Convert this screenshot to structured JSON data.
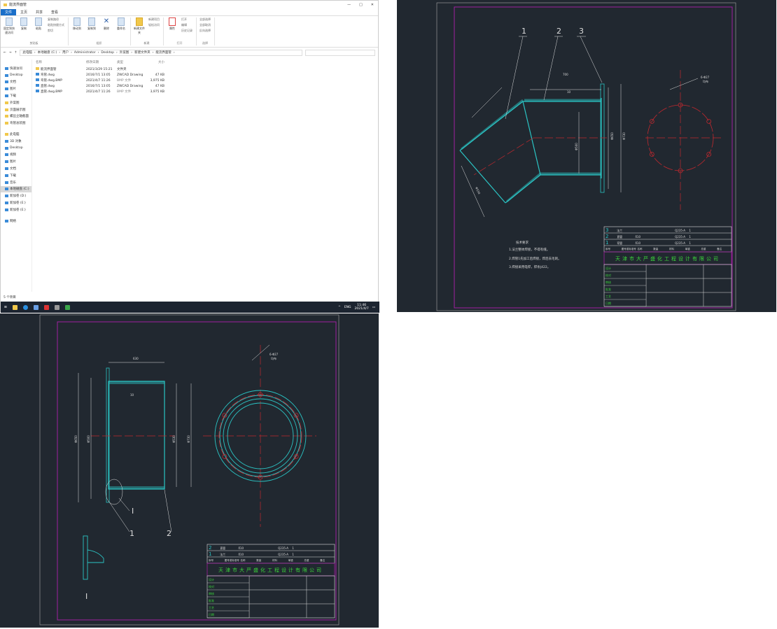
{
  "explorer": {
    "title": "能流界面管",
    "tabs": [
      "文件",
      "主页",
      "共享",
      "查看"
    ],
    "ribbon": {
      "clipboard": {
        "label": "剪贴板",
        "pin": "固定到快速访问",
        "copy": "复制",
        "paste": "粘贴",
        "copy_path": "复制路径",
        "paste_shortcut": "粘贴快捷方式",
        "cut": "剪切"
      },
      "organize": {
        "label": "组织",
        "move_to": "移动到",
        "copy_to": "复制到",
        "delete": "删除",
        "rename": "重命名"
      },
      "new": {
        "label": "新建",
        "new_folder": "新建文件夹",
        "new_item": "新建项目",
        "easy_access": "轻松访问"
      },
      "open": {
        "label": "打开",
        "properties": "属性",
        "open": "打开",
        "edit": "编辑",
        "history": "历史记录"
      },
      "select": {
        "label": "选择",
        "select_all": "全部选择",
        "select_none": "全部取消",
        "invert": "反向选择"
      }
    },
    "breadcrumb": [
      "此电脑",
      "本地磁盘 (C:)",
      "用户",
      "Administrator",
      "Desktop",
      "外案图",
      "新建文件夹",
      "能流界面管"
    ],
    "sidebar": [
      "快速访问",
      "Desktop",
      "文档",
      "图片",
      "下载",
      "外案图",
      "页面展示图",
      "螺丝立轴截面",
      "弯管总装图",
      "此电脑",
      "3D 对象",
      "Desktop",
      "视频",
      "图片",
      "文档",
      "下载",
      "音乐",
      "本地磁盘 (C:)",
      "新加卷 (D:)",
      "新加卷 (E:)",
      "新加卷 (E:)",
      "网络"
    ],
    "columns": [
      "名称",
      "修改日期",
      "类型",
      "大小"
    ],
    "files": [
      {
        "name": "能流界面管",
        "date": "2021/3/29 15:21",
        "type": "文件夹",
        "size": "",
        "icon": "folder-icon"
      },
      {
        "name": "弯管.dwg",
        "date": "2016/7/1 13:05",
        "type": "ZWCAD Drawing",
        "size": "47 KB",
        "icon": "dwg-file-icon"
      },
      {
        "name": "弯管.dwg.BMP",
        "date": "2021/4/7 11:26",
        "type": "BMP 文件",
        "size": "3,975 KB",
        "icon": "bmp-file-icon"
      },
      {
        "name": "直管.dwg",
        "date": "2016/7/1 13:05",
        "type": "ZWCAD Drawing",
        "size": "47 KB",
        "icon": "dwg-file-icon"
      },
      {
        "name": "直管.dwg.BMP",
        "date": "2021/4/7 11:26",
        "type": "BMP 文件",
        "size": "3,975 KB",
        "icon": "bmp-file-icon"
      }
    ],
    "status": "5 个项目",
    "taskbar": {
      "lang": "ENG",
      "time": "11:46",
      "date": "2021/4/7"
    }
  },
  "cad_elbow": {
    "labels": [
      "1",
      "2",
      "3"
    ],
    "dims": {
      "length": "700",
      "bolt": "6-Φ27",
      "even": "均布",
      "d1": "Φ730",
      "d2": "Φ650",
      "d3": "Φ500",
      "d4": "Φ530",
      "t": "10"
    },
    "notes_title": "技术要求",
    "notes": [
      "1.法兰整体焊接，不得有缝。",
      "2.焊管1先加工后焊接，焊后去毛刺。",
      "3.焊接采用电焊，焊条J422。"
    ],
    "parts": [
      {
        "no": "3",
        "name": "法兰",
        "mat": "Q235-A",
        "qty": "1"
      },
      {
        "no": "2",
        "name": "直管",
        "spec": "δ10",
        "mat": "Q235-A",
        "qty": "1"
      },
      {
        "no": "1",
        "name": "弯管",
        "spec": "δ10",
        "mat": "Q235-A",
        "qty": "1"
      }
    ],
    "header": [
      "序号",
      "图号或标准号",
      "名称",
      "数量",
      "材料",
      "单重",
      "总重",
      "备注"
    ],
    "company": "天津市大严盛化工程设计有限公司",
    "block": [
      "设计",
      "校对",
      "审核",
      "批准",
      "工艺",
      "日期"
    ]
  },
  "cad_straight": {
    "labels": [
      "1",
      "2",
      "I"
    ],
    "dims": {
      "length": "630",
      "bolt": "6-Φ27",
      "even": "均布",
      "d1": "Φ650",
      "d2": "Φ730",
      "d3": "Φ500",
      "d4": "Φ530",
      "t": "10"
    },
    "detail": "I",
    "parts": [
      {
        "no": "2",
        "name": "直管",
        "spec": "δ10",
        "mat": "Q235-A",
        "qty": "1"
      },
      {
        "no": "1",
        "name": "法兰",
        "spec": "δ10",
        "mat": "Q235-A",
        "qty": "1"
      }
    ],
    "company": "天津市大严盛化工程设计有限公司"
  },
  "colors": {
    "cad_bg": "#212830",
    "cyan": "#2bc4c4",
    "red": "#c0282e",
    "magenta": "#a020a0",
    "green": "#3ad43a"
  }
}
